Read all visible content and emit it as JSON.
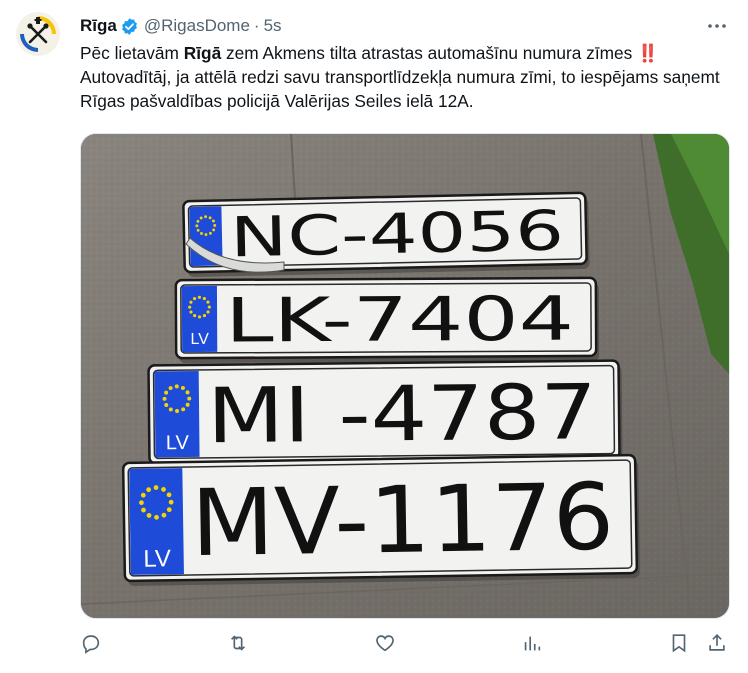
{
  "account": {
    "name": "Rīga",
    "handle": "@RigasDome",
    "separator": "·",
    "time": "5s"
  },
  "tweet": {
    "line1_pre": "Pēc lietavām ",
    "line1_bold": "Rīgā",
    "line1_post": " zem Akmens tilta atrastas automašīnu numura zīmes ",
    "exclamation": "‼️",
    "line2": "Autovadītāj, ja attēlā redzi savu transportlīdzekļa numura zīmi, to iespējams saņemt Rīgas pašvaldības policijā Valērijas Seiles ielā 12A."
  },
  "photo": {
    "plates": [
      {
        "number": "NC-4056",
        "country": ""
      },
      {
        "number": "LK-7404",
        "country": "LV"
      },
      {
        "number": "MI -4787",
        "country": "LV"
      },
      {
        "number": "MV-1176",
        "country": "LV"
      }
    ]
  },
  "actions": [
    "reply-icon",
    "retweet-icon",
    "like-icon",
    "views-icon",
    "bookmark-icon",
    "share-icon"
  ],
  "colors": {
    "accent": "#1d9bf0",
    "text": "#0f1419",
    "muted": "#536471",
    "plate_blue": "#1e4bd8",
    "stars": "#f5d300"
  }
}
